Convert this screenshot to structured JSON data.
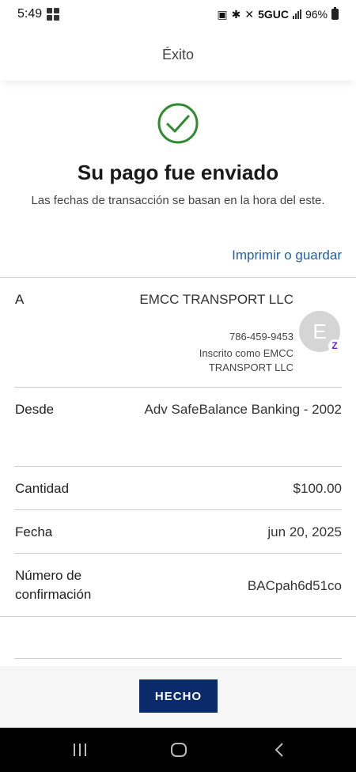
{
  "status": {
    "time": "5:49",
    "network": "5GUC",
    "battery": "96%"
  },
  "header": {
    "title": "Éxito"
  },
  "success": {
    "title": "Su pago fue enviado",
    "subtitle": "Las fechas de transacción se basan en la hora del este.",
    "print_link": "Imprimir o guardar"
  },
  "details": {
    "to": {
      "label": "A",
      "name": "EMCC TRANSPORT LLC",
      "phone": "786-459-9453",
      "enrolled": "Inscrito como EMCC TRANSPORT LLC",
      "avatar_letter": "E",
      "badge": "Z"
    },
    "from": {
      "label": "Desde",
      "value": "Adv SafeBalance Banking - 2002"
    },
    "amount": {
      "label": "Cantidad",
      "value": "$100.00"
    },
    "date": {
      "label": "Fecha",
      "value": "jun 20, 2025"
    },
    "confirmation": {
      "label": "Número de confirmación",
      "value": "BACpah6d51co"
    }
  },
  "footer": {
    "done_label": "HECHO"
  },
  "colors": {
    "accent": "#1f5fa8",
    "success": "#2e8b2e",
    "button": "#0b2a6b"
  }
}
